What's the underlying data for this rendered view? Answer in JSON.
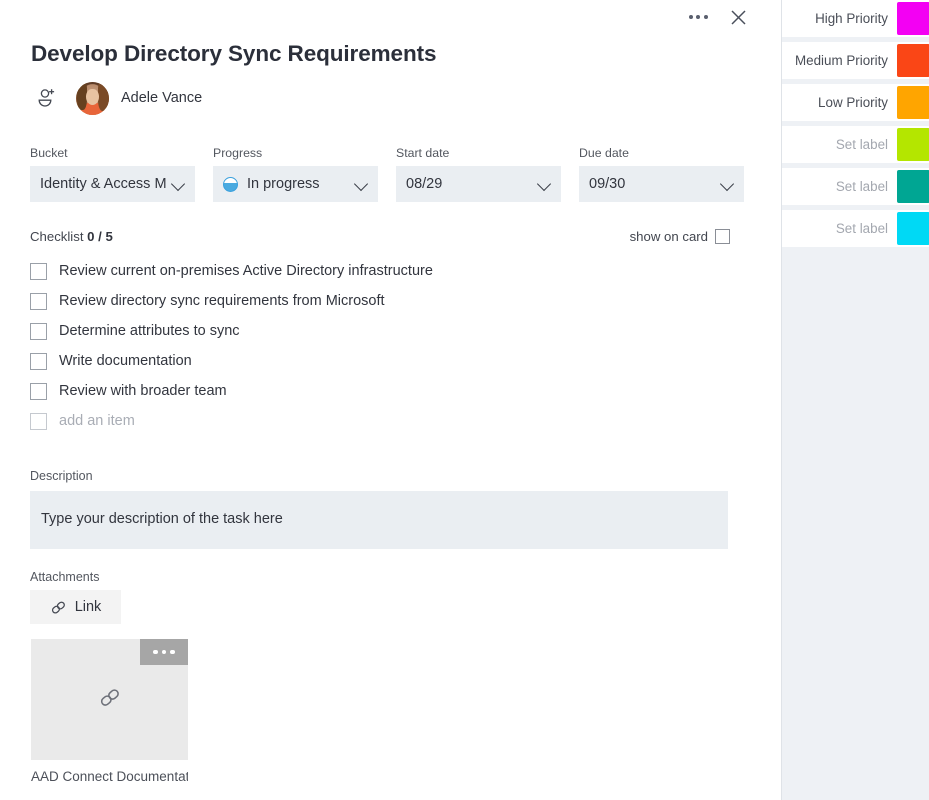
{
  "header": {
    "title": "Develop Directory Sync Requirements",
    "more_options_icon": "ellipsis-icon",
    "close_icon": "close-icon"
  },
  "assignee": {
    "add_icon": "add-person-icon",
    "avatar_icon": "avatar-photo",
    "name": "Adele Vance"
  },
  "fields": [
    {
      "label": "Bucket",
      "value": "Identity & Access M",
      "icon": null,
      "chevron": "chevron-down-icon"
    },
    {
      "label": "Progress",
      "value": "In progress",
      "icon": "progress-in-progress-icon",
      "chevron": "chevron-down-icon"
    },
    {
      "label": "Start date",
      "value": "08/29",
      "icon": null,
      "chevron": "chevron-down-icon"
    },
    {
      "label": "Due date",
      "value": "09/30",
      "icon": null,
      "chevron": "chevron-down-icon"
    }
  ],
  "checklist": {
    "title_prefix": "Checklist",
    "count": "0 / 5",
    "completed": 0,
    "total": 5,
    "show_on_card_label": "show on card",
    "show_on_card_checked": false,
    "items": [
      {
        "text": "Review current on-premises Active Directory infrastructure",
        "checked": false
      },
      {
        "text": "Review directory sync requirements from Microsoft",
        "checked": false
      },
      {
        "text": "Determine attributes to sync",
        "checked": false
      },
      {
        "text": "Write documentation",
        "checked": false
      },
      {
        "text": "Review with broader team",
        "checked": false
      }
    ],
    "add_item_placeholder": "add an item"
  },
  "description": {
    "label": "Description",
    "placeholder": "Type your description of the task here",
    "value": ""
  },
  "attachments": {
    "label": "Attachments",
    "link_button_label": "Link",
    "link_button_icon": "link-icon",
    "items": [
      {
        "name": "AAD Connect Documentatio",
        "thumb_icon": "link-icon",
        "more_icon": "ellipsis-icon"
      }
    ]
  },
  "labels": {
    "items": [
      {
        "text": "High Priority",
        "color": "#f300f3",
        "is_set": true
      },
      {
        "text": "Medium Priority",
        "color": "#fa4616",
        "is_set": true
      },
      {
        "text": "Low Priority",
        "color": "#ffa500",
        "is_set": true
      },
      {
        "text": "Set label",
        "color": "#b4e600",
        "is_set": false
      },
      {
        "text": "Set label",
        "color": "#00a693",
        "is_set": false
      },
      {
        "text": "Set label",
        "color": "#00d9f5",
        "is_set": false
      }
    ]
  },
  "colors": {
    "field_background": "#eaeef2",
    "panel_background": "#eef1f5",
    "text_primary": "#32353e",
    "text_secondary": "#53575f",
    "text_muted": "#a9adb5"
  }
}
